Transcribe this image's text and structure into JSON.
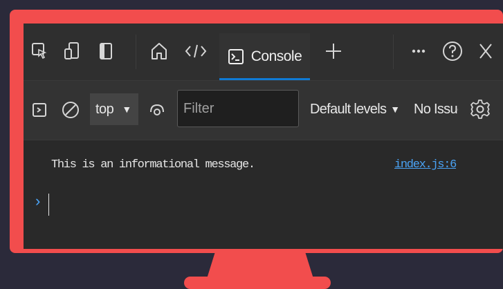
{
  "tabs": {
    "console_label": "Console"
  },
  "toolbar": {
    "context_value": "top",
    "filter_placeholder": "Filter",
    "levels_label": "Default levels",
    "issues_label": "No Issues"
  },
  "console": {
    "message": "This is an informational message.",
    "source_link": "index.js:6",
    "prompt_symbol": "›"
  },
  "colors": {
    "frame": "#f24d4d",
    "background": "#2b2a3a",
    "screen": "#292929",
    "accent": "#0f7ad5",
    "link": "#4aa3f5"
  },
  "icons": [
    "inspect-element-icon",
    "device-toolbar-icon",
    "dock-panel-icon",
    "home-icon",
    "elements-code-icon",
    "console-icon",
    "add-tab-icon",
    "more-options-icon",
    "help-icon",
    "close-icon",
    "sidebar-toggle-icon",
    "clear-console-icon",
    "live-expression-eye-icon",
    "settings-gear-icon"
  ]
}
